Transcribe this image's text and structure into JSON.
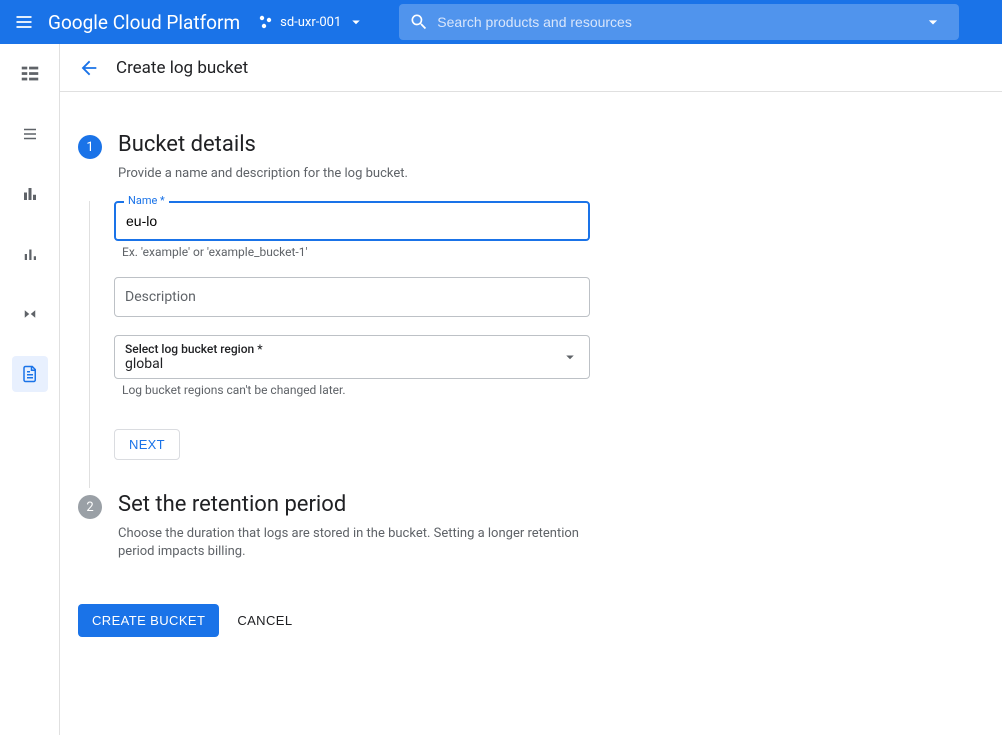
{
  "topbar": {
    "logo": "Google Cloud Platform",
    "project_name": "sd-uxr-001",
    "search_placeholder": "Search products and resources"
  },
  "subheader": {
    "title": "Create log bucket"
  },
  "steps": {
    "s1": {
      "num": "1",
      "title": "Bucket details",
      "desc": "Provide a name and description for the log bucket."
    },
    "s2": {
      "num": "2",
      "title": "Set the retention period",
      "desc": "Choose the duration that logs are stored in the bucket. Setting a longer retention period impacts billing."
    }
  },
  "form": {
    "name_label": "Name *",
    "name_value": "eu-lo",
    "name_helper": "Ex. 'example' or 'example_bucket-1'",
    "description_placeholder": "Description",
    "region_label": "Select log bucket region *",
    "region_value": "global",
    "region_helper": "Log bucket regions can't be changed later.",
    "next_label": "NEXT"
  },
  "actions": {
    "create_label": "CREATE BUCKET",
    "cancel_label": "CANCEL"
  }
}
